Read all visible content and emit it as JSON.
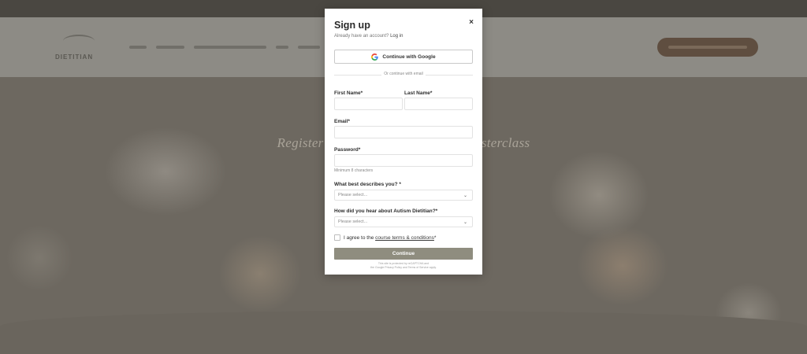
{
  "colors": {
    "overlay_bg": "#6f6a61",
    "modal_bg": "#ffffff",
    "continue_button": "#8f8d7f",
    "header_cta": "#5f4e40"
  },
  "background": {
    "logo_text": "DIETITIAN",
    "hero_title": "Register for the Autism Dietitian Masterclass"
  },
  "modal": {
    "title": "Sign up",
    "subtitle_prefix": "Already have an account?",
    "login_link": "Log in",
    "close_icon": "×",
    "google_button": "Continue with Google",
    "divider_text": "Or continue with email",
    "first_name_label": "First Name*",
    "last_name_label": "Last Name*",
    "email_label": "Email*",
    "password_label": "Password*",
    "password_hint": "Minimum 8 characters",
    "describe_label": "What best describes you? *",
    "describe_placeholder": "Please select...",
    "hear_label": "How did you hear about Autism Dietitian?*",
    "hear_placeholder": "Please select...",
    "agree_prefix": "I agree to the",
    "terms_link": "course terms & conditions",
    "agree_suffix": "*",
    "continue_button": "Continue",
    "recaptcha_line1": "This site is protected by reCAPTCHA and",
    "recaptcha_line2": "the Google Privacy Policy and Terms of Service apply."
  }
}
